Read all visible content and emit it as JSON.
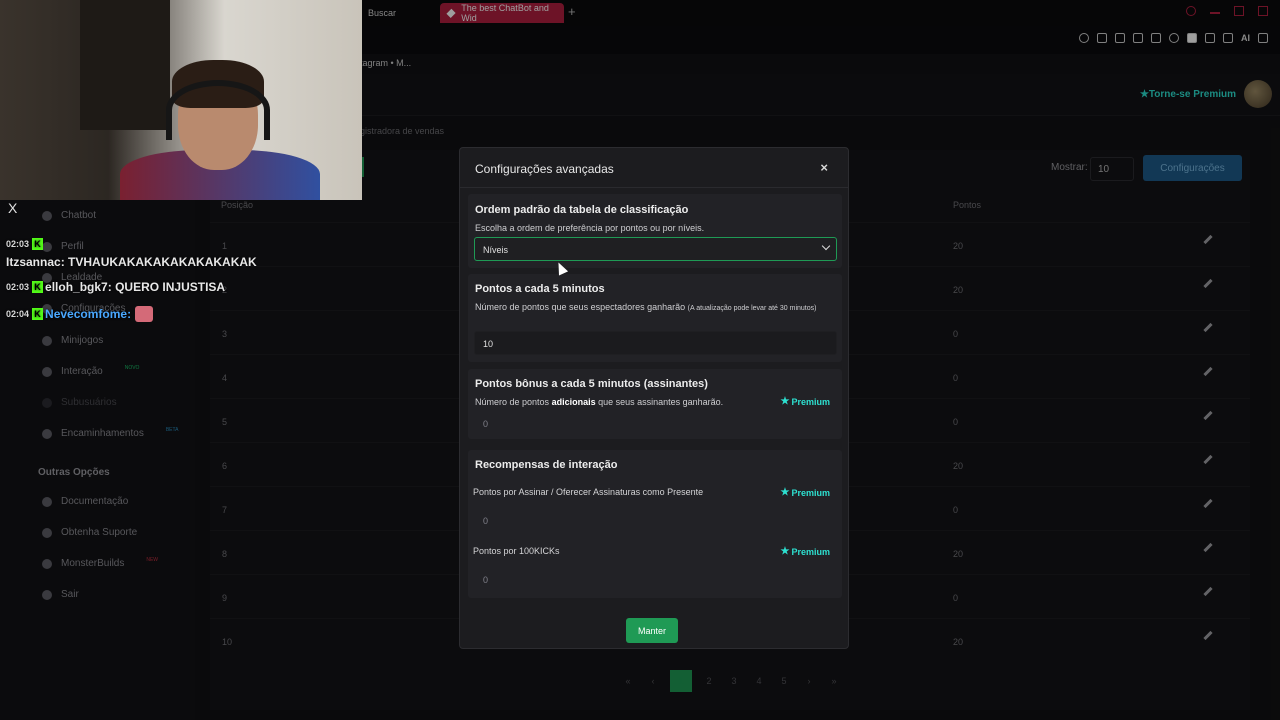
{
  "browser": {
    "tab_search": "Buscar",
    "tab_active": "The best ChatBot and Wid",
    "tab_plus": "+",
    "bookmark": "tagram • M...",
    "ai_label": "AI"
  },
  "header": {
    "premium_cta": "★Torne-se Premium"
  },
  "breadcrumb": "gistradora de vendas",
  "sidebar": {
    "close": "X",
    "items": [
      {
        "label": "Chatbot"
      },
      {
        "label": "Perfil"
      },
      {
        "label": "Lealdade"
      },
      {
        "label": "Configurações"
      },
      {
        "label": "Minijogos"
      },
      {
        "label": "Interação",
        "badge": "NOVO"
      },
      {
        "label": "Subusuários"
      },
      {
        "label": "Encaminhamentos",
        "badge": "BETA"
      }
    ],
    "section_title": "Outras Opções",
    "other_items": [
      {
        "label": "Documentação"
      },
      {
        "label": "Obtenha Suporte"
      },
      {
        "label": "MonsterBuilds",
        "badge": "NEW"
      },
      {
        "label": "Sair"
      }
    ]
  },
  "chat": [
    {
      "time": "02:03",
      "user": "Itzsannac",
      "message": "TVHAUKAKAKAKAKAKAKAKAK"
    },
    {
      "time": "02:03",
      "user": "elloh_bgk7",
      "message": "QUERO INJUSTISA"
    },
    {
      "time": "02:04",
      "user": "Nevecomfome",
      "message": ""
    }
  ],
  "table": {
    "mostrar_label": "Mostrar:",
    "mostrar_value": "10",
    "config_button": "Configurações",
    "col_position": "Posição",
    "col_points": "Pontos",
    "rows": [
      {
        "pos": "1",
        "pts": "20"
      },
      {
        "pos": "2",
        "pts": "20"
      },
      {
        "pos": "3",
        "pts": "0"
      },
      {
        "pos": "4",
        "pts": "0"
      },
      {
        "pos": "5",
        "pts": "0"
      },
      {
        "pos": "6",
        "pts": "20"
      },
      {
        "pos": "7",
        "pts": "0"
      },
      {
        "pos": "8",
        "pts": "20"
      },
      {
        "pos": "9",
        "pts": "0"
      },
      {
        "pos": "10",
        "pts": "20"
      }
    ],
    "pages": [
      "«",
      "‹",
      "1",
      "2",
      "3",
      "4",
      "5",
      "›",
      "»"
    ]
  },
  "modal": {
    "title": "Configurações avançadas",
    "close": "×",
    "order": {
      "heading": "Ordem padrão da tabela de classificação",
      "sub": "Escolha a ordem de preferência por pontos ou por níveis.",
      "value": "Níveis"
    },
    "points": {
      "heading": "Pontos a cada 5 minutos",
      "sub": "Número de pontos que seus espectadores ganharão",
      "note": "(A atualização pode levar até 30 minutos)",
      "value": "10"
    },
    "bonus": {
      "heading": "Pontos bônus a cada 5 minutos (assinantes)",
      "sub_pre": "Número de pontos",
      "sub_bold": "adicionais",
      "sub_post": "que seus assinantes ganharão.",
      "premium": "Premium",
      "value": "0"
    },
    "rewards": {
      "heading": "Recompensas de interação",
      "sub_label": "Pontos por Assinar / Oferecer Assinaturas como Presente",
      "sub_value": "0",
      "kicks_label": "Pontos por 100KICKs",
      "kicks_value": "0",
      "premium": "Premium"
    },
    "save_button": "Manter"
  }
}
